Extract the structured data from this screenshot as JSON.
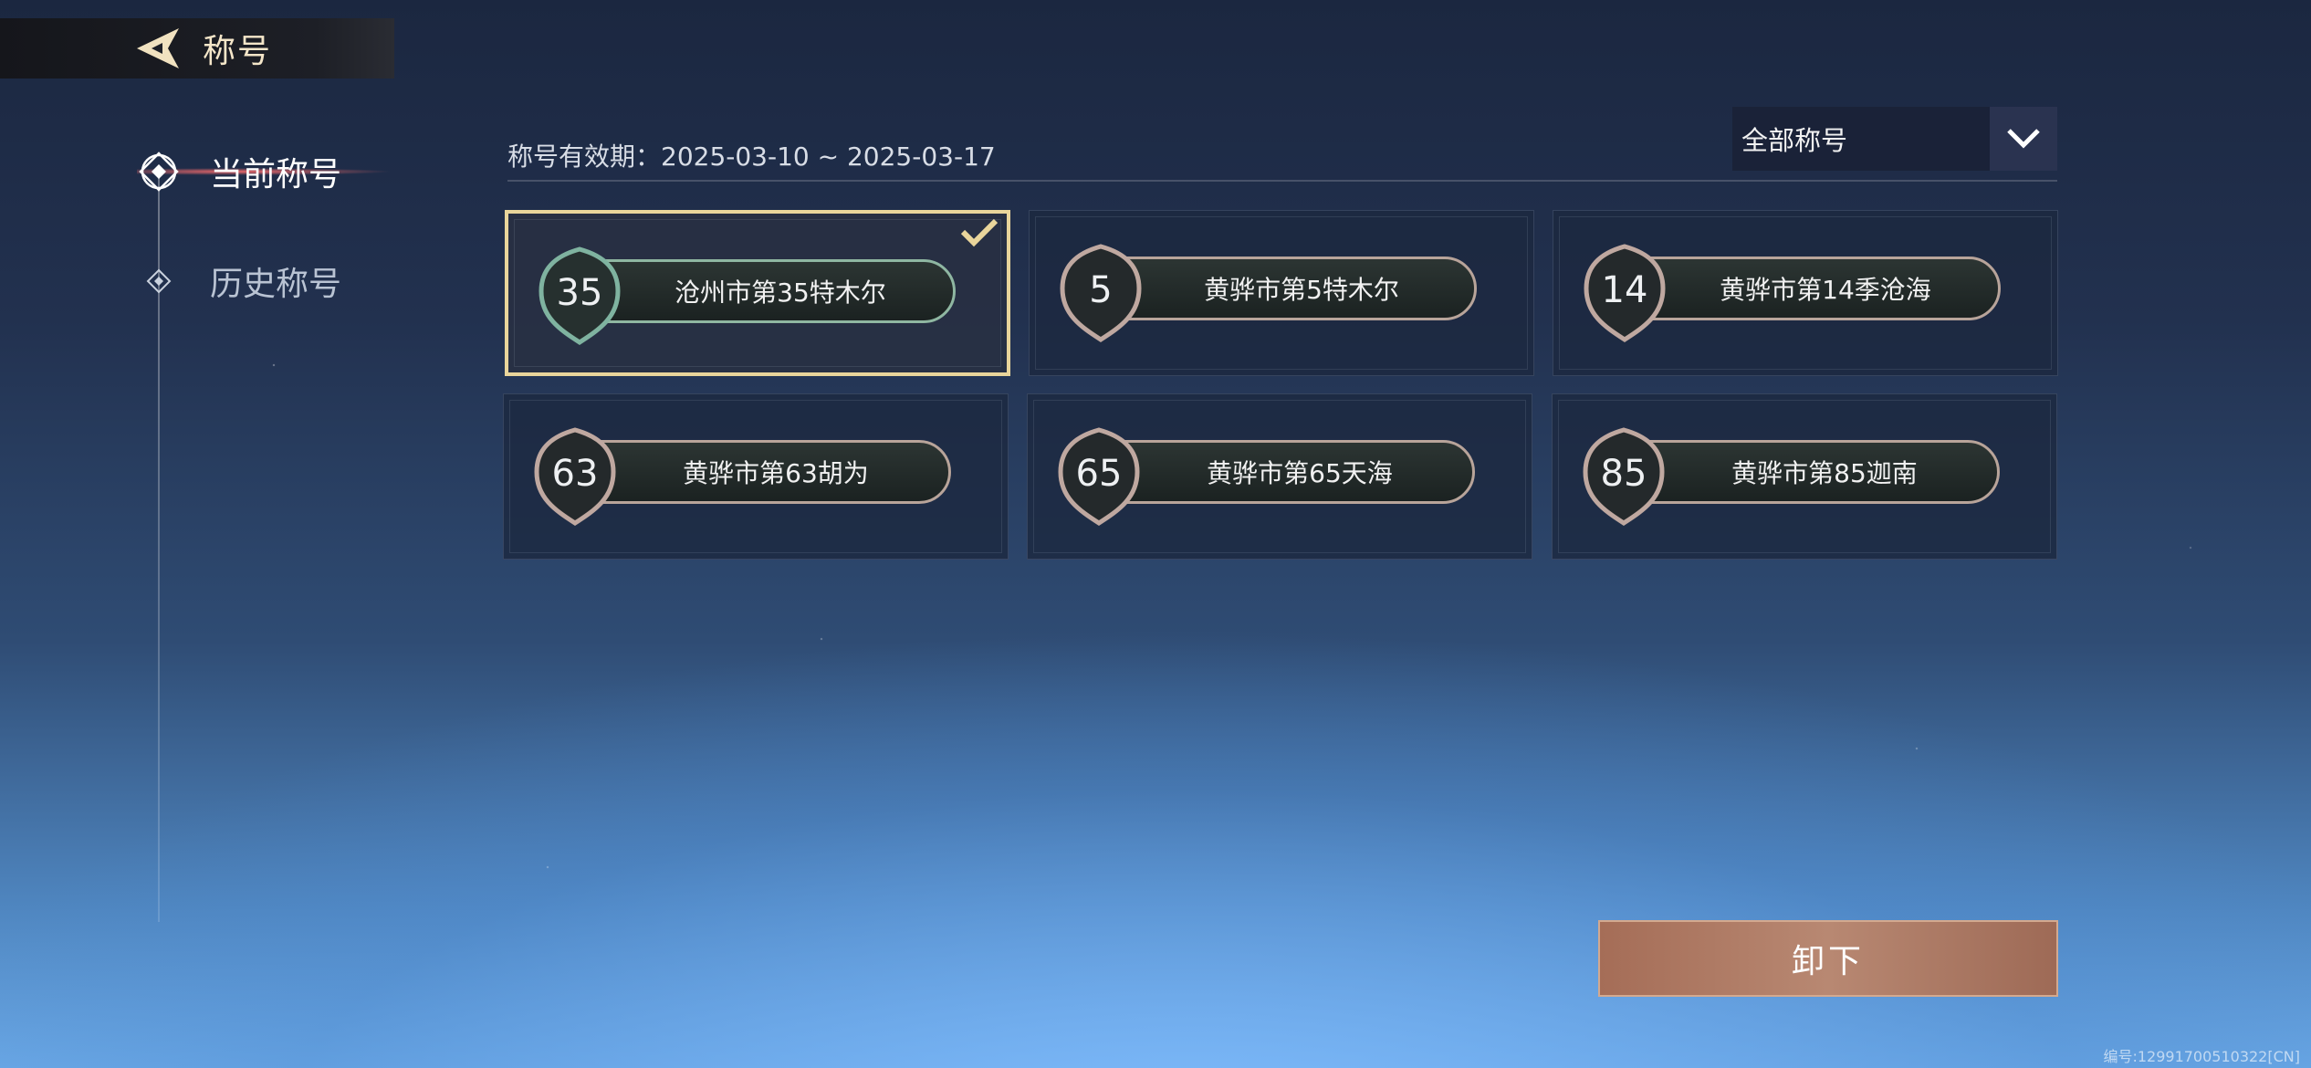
{
  "header": {
    "title": "称号",
    "back_icon": "back-arrow-icon"
  },
  "nav": {
    "items": [
      {
        "label": "当前称号",
        "active": true
      },
      {
        "label": "历史称号",
        "active": false
      }
    ]
  },
  "validity": {
    "text": "称号有效期：2025-03-10 ~ 2025-03-17"
  },
  "filter": {
    "value": "全部称号",
    "icon": "chevron-down-icon"
  },
  "titles": [
    {
      "number": "35",
      "name": "沧州市第35特木尔",
      "selected": true
    },
    {
      "number": "5",
      "name": "黄骅市第5特木尔",
      "selected": false
    },
    {
      "number": "14",
      "name": "黄骅市第14季沧海",
      "selected": false
    },
    {
      "number": "63",
      "name": "黄骅市第63胡为",
      "selected": false
    },
    {
      "number": "65",
      "name": "黄骅市第65天海",
      "selected": false
    },
    {
      "number": "85",
      "name": "黄骅市第85迦南",
      "selected": false
    }
  ],
  "actions": {
    "unload_label": "卸下"
  },
  "footer": {
    "id_text": "编号:1299170051032​2[CN]"
  },
  "colors": {
    "accent_gold": "#e9d59b",
    "button": "#b88872",
    "active_glow": "#ff6e6e"
  }
}
